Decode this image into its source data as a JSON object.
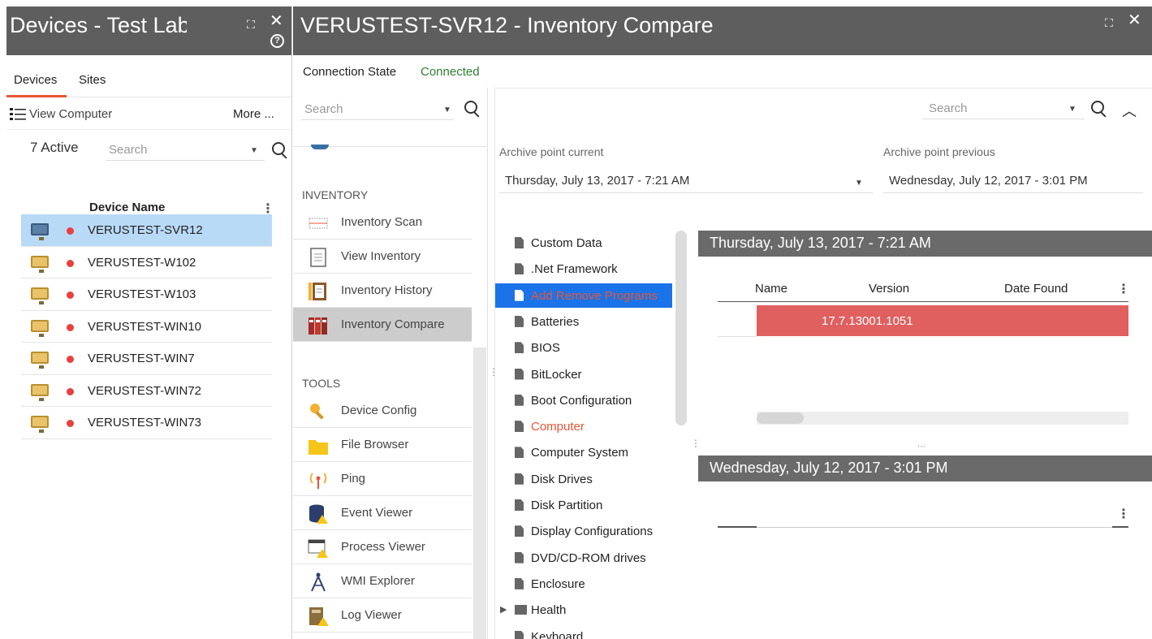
{
  "left_panel": {
    "title": "Devices - Test Lab",
    "tabs": [
      "Devices",
      "Sites"
    ],
    "view_computer": "View Computer",
    "more": "More ...",
    "active_count": "7 Active",
    "search_placeholder": "Search",
    "column_header": "Device Name",
    "devices": [
      {
        "name": "VERUSTEST-SVR12",
        "selected": true,
        "status_color": "#e84040"
      },
      {
        "name": "VERUSTEST-W102",
        "selected": false,
        "status_color": "#e84040"
      },
      {
        "name": "VERUSTEST-W103",
        "selected": false,
        "status_color": "#e84040"
      },
      {
        "name": "VERUSTEST-WIN10",
        "selected": false,
        "status_color": "#e84040"
      },
      {
        "name": "VERUSTEST-WIN7",
        "selected": false,
        "status_color": "#e84040"
      },
      {
        "name": "VERUSTEST-WIN72",
        "selected": false,
        "status_color": "#e84040"
      },
      {
        "name": "VERUSTEST-WIN73",
        "selected": false,
        "status_color": "#e84040"
      }
    ]
  },
  "main_panel": {
    "title": "VERUSTEST-SVR12 - Inventory Compare",
    "connection_label": "Connection State",
    "connection_value": "Connected",
    "nav_search_placeholder": "Search",
    "right_search_placeholder": "Search",
    "sections": {
      "inventory": "INVENTORY",
      "tools": "TOOLS"
    },
    "inventory_items": [
      {
        "label": "Inventory Scan",
        "icon": "barcode-icon",
        "active": false
      },
      {
        "label": "View Inventory",
        "icon": "clipboard-icon",
        "active": false
      },
      {
        "label": "Inventory History",
        "icon": "history-clipboard-icon",
        "active": false
      },
      {
        "label": "Inventory Compare",
        "icon": "binders-icon",
        "active": true
      }
    ],
    "tool_items": [
      {
        "label": "Device Config",
        "icon": "key-icon"
      },
      {
        "label": "File Browser",
        "icon": "folder-icon"
      },
      {
        "label": "Ping",
        "icon": "antenna-icon"
      },
      {
        "label": "Event Viewer",
        "icon": "database-icon"
      },
      {
        "label": "Process Viewer",
        "icon": "window-warning-icon"
      },
      {
        "label": "WMI Explorer",
        "icon": "compass-icon"
      },
      {
        "label": "Log Viewer",
        "icon": "log-book-icon"
      }
    ],
    "archive_current_label": "Archive point current",
    "archive_current_value": "Thursday, July 13, 2017 - 7:21 AM",
    "archive_previous_label": "Archive point previous",
    "archive_previous_value": "Wednesday, July 12, 2017 - 3:01 PM",
    "tree": [
      {
        "label": "Custom Data",
        "type": "file"
      },
      {
        "label": ".Net Framework",
        "type": "file"
      },
      {
        "label": "Add Remove Programs",
        "type": "file",
        "selected": true,
        "red": true
      },
      {
        "label": "Batteries",
        "type": "file"
      },
      {
        "label": "BIOS",
        "type": "file"
      },
      {
        "label": "BitLocker",
        "type": "file"
      },
      {
        "label": "Boot Configuration",
        "type": "file"
      },
      {
        "label": "Computer",
        "type": "file",
        "red": true
      },
      {
        "label": "Computer System",
        "type": "file"
      },
      {
        "label": "Disk Drives",
        "type": "file"
      },
      {
        "label": "Disk Partition",
        "type": "file"
      },
      {
        "label": "Display Configurations",
        "type": "file"
      },
      {
        "label": "DVD/CD-ROM drives",
        "type": "file"
      },
      {
        "label": "Enclosure",
        "type": "file"
      },
      {
        "label": "Health",
        "type": "folder"
      },
      {
        "label": "Keyboard",
        "type": "file"
      }
    ],
    "pane_current_header": "Thursday, July 13, 2017 - 7:21 AM",
    "pane_previous_header": "Wednesday, July 12, 2017 - 3:01 PM",
    "columns": [
      "Name",
      "Version",
      "Date Found"
    ],
    "rows": [
      {
        "version": "17.7.13001.1051"
      }
    ],
    "row_highlight_color": "#e06060"
  }
}
